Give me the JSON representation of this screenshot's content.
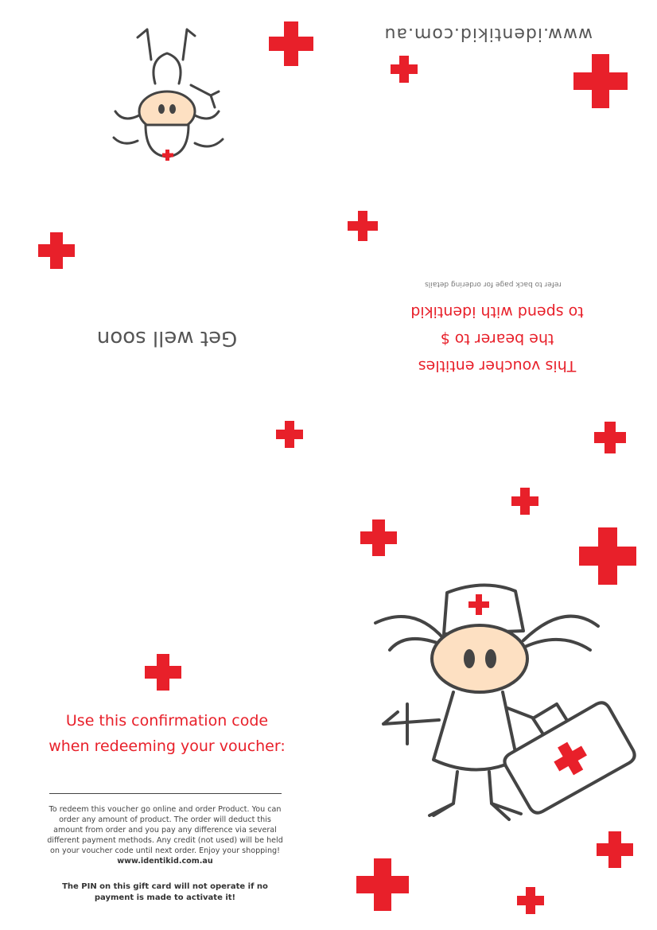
{
  "top_panel": {
    "website": "www.identikid.com.au",
    "greeting": "Get well soon",
    "voucher_lines": [
      "This voucher entitles",
      "the bearer to $",
      "to spend with identikid"
    ],
    "refer_note": "refer to back page for ordering details"
  },
  "bottom_panel": {
    "confirm_lines": [
      "Use this confirmation code",
      "when redeeming your voucher:"
    ],
    "terms_text": "To redeem this voucher go online and order Product. You can order any amount of product. The order will deduct this amount from order and you pay any difference via several different payment methods. Any credit (not used) will be held on your voucher code until next order. Enjoy your shopping!",
    "terms_link": "www.identikid.com.au",
    "pin_notice": "The PIN on this gift card will not operate if no payment is made to activate it!"
  },
  "colors": {
    "accent": "#e8202a",
    "skin": "#fde0c2",
    "ink": "#444444"
  },
  "icons": [
    "red-cross-icon",
    "nurse-illustration",
    "first-aid-kit-icon"
  ]
}
